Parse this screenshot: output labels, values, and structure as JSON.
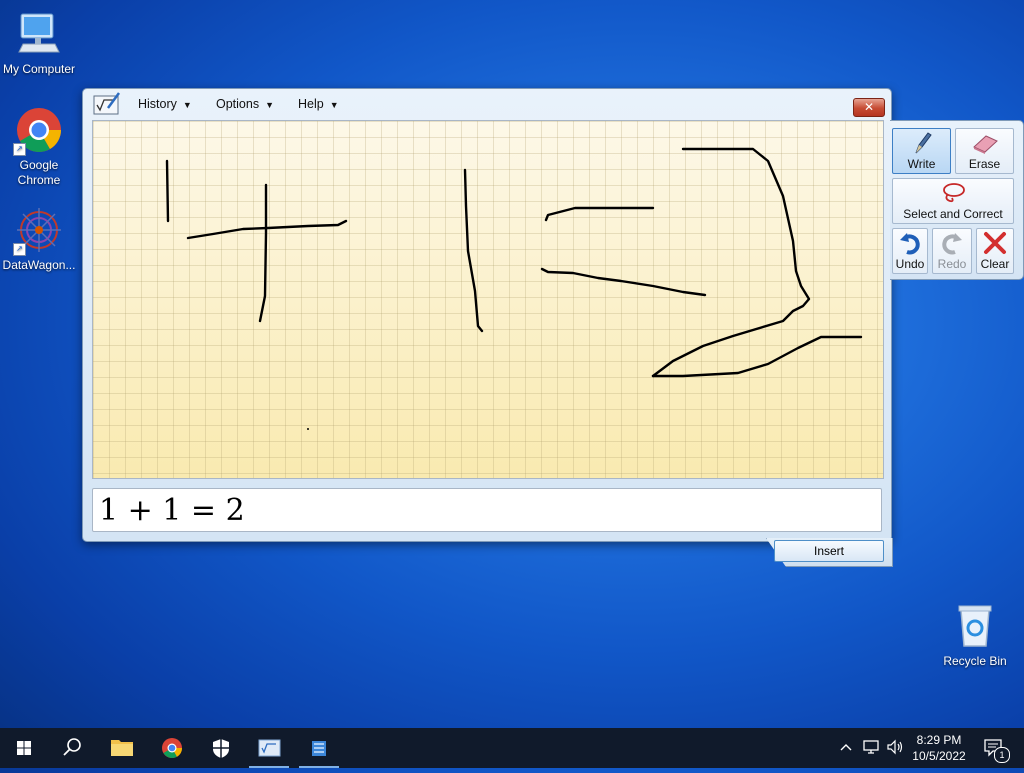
{
  "desktop": {
    "icons": [
      {
        "label": "My Computer"
      },
      {
        "label": "Google Chrome"
      },
      {
        "label": "DataWagon..."
      },
      {
        "label": "Recycle Bin"
      }
    ]
  },
  "math_panel": {
    "menus": [
      {
        "label": "History"
      },
      {
        "label": "Options"
      },
      {
        "label": "Help"
      }
    ],
    "close_label": "✕",
    "recognized_text": "1 + 1 = 2",
    "insert_label": "Insert",
    "tools": {
      "write": "Write",
      "erase": "Erase",
      "select_correct": "Select and Correct",
      "undo": "Undo",
      "redo": "Redo",
      "clear": "Clear"
    },
    "colors": {
      "canvas": "#fbf0c0",
      "ink": "#000000"
    }
  },
  "taskbar": {
    "time": "8:29 PM",
    "date": "10/5/2022",
    "notification_count": "1"
  }
}
